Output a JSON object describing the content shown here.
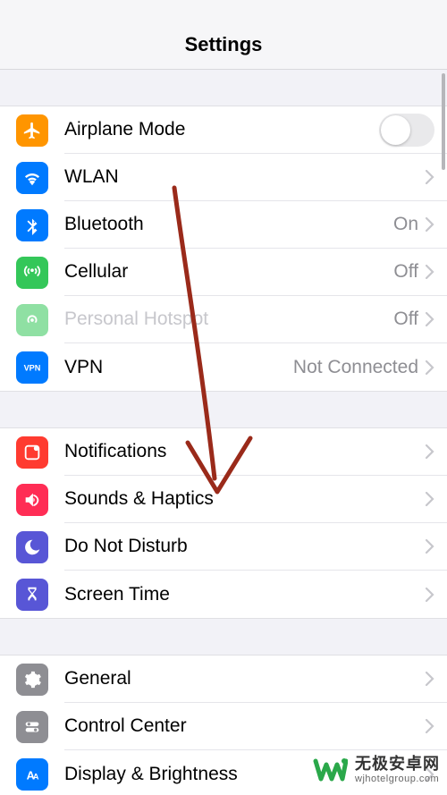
{
  "header": {
    "title": "Settings"
  },
  "colors": {
    "orange": "#ff9500",
    "blue": "#007aff",
    "green": "#34c759",
    "greenAlt": "#30d158",
    "grey": "#8e8e93",
    "red": "#ff3b30",
    "purple": "#5856d6",
    "indigo": "#5e5ce6"
  },
  "group1": [
    {
      "key": "airplane",
      "label": "Airplane Mode",
      "value": "",
      "toggle": true,
      "chevron": false,
      "icon": "airplane-icon",
      "bg": "#ff9500"
    },
    {
      "key": "wlan",
      "label": "WLAN",
      "value": "",
      "toggle": false,
      "chevron": true,
      "icon": "wifi-icon",
      "bg": "#007aff"
    },
    {
      "key": "bluetooth",
      "label": "Bluetooth",
      "value": "On",
      "toggle": false,
      "chevron": true,
      "icon": "bluetooth-icon",
      "bg": "#007aff"
    },
    {
      "key": "cellular",
      "label": "Cellular",
      "value": "Off",
      "toggle": false,
      "chevron": true,
      "icon": "antenna-icon",
      "bg": "#34c759"
    },
    {
      "key": "hotspot",
      "label": "Personal Hotspot",
      "value": "Off",
      "toggle": false,
      "chevron": true,
      "icon": "hotspot-icon",
      "bg": "#34c759",
      "dim": true
    },
    {
      "key": "vpn",
      "label": "VPN",
      "value": "Not Connected",
      "toggle": false,
      "chevron": true,
      "icon": "vpn-icon",
      "bg": "#007aff"
    }
  ],
  "group2": [
    {
      "key": "notifications",
      "label": "Notifications",
      "icon": "notifications-icon",
      "bg": "#ff3b30"
    },
    {
      "key": "sounds",
      "label": "Sounds & Haptics",
      "icon": "sounds-icon",
      "bg": "#ff3b30"
    },
    {
      "key": "dnd",
      "label": "Do Not Disturb",
      "icon": "moon-icon",
      "bg": "#5856d6"
    },
    {
      "key": "screentime",
      "label": "Screen Time",
      "icon": "hourglass-icon",
      "bg": "#5856d6"
    }
  ],
  "group3": [
    {
      "key": "general",
      "label": "General",
      "icon": "gear-icon",
      "bg": "#8e8e93"
    },
    {
      "key": "controlcenter",
      "label": "Control Center",
      "icon": "switches-icon",
      "bg": "#8e8e93"
    },
    {
      "key": "display",
      "label": "Display & Brightness",
      "icon": "text-size-icon",
      "bg": "#007aff"
    }
  ],
  "watermark": {
    "main": "无极安卓网",
    "sub": "wjhotelgroup.com"
  }
}
